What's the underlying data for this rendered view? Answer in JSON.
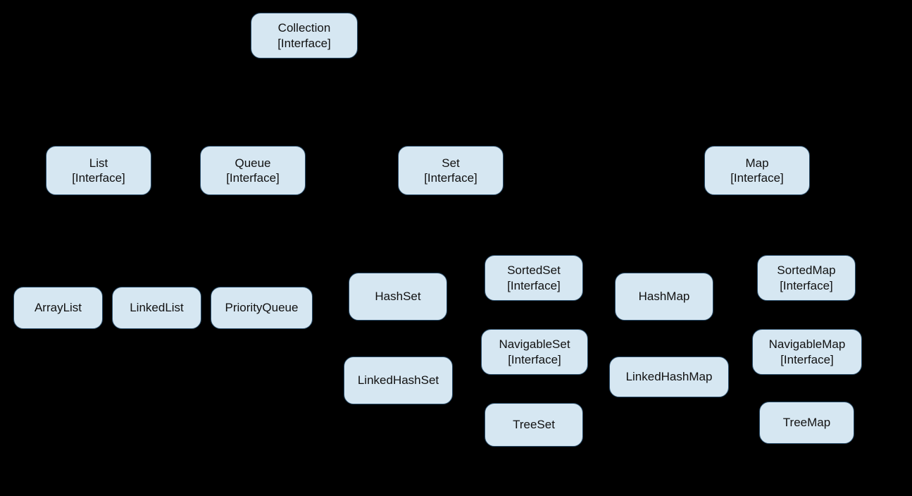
{
  "diagram": {
    "nodes": {
      "collection": {
        "title": "Collection",
        "sub": "[Interface]"
      },
      "list": {
        "title": "List",
        "sub": "[Interface]"
      },
      "queue": {
        "title": "Queue",
        "sub": "[Interface]"
      },
      "set": {
        "title": "Set",
        "sub": "[Interface]"
      },
      "map": {
        "title": "Map",
        "sub": "[Interface]"
      },
      "arraylist": {
        "title": "ArrayList",
        "sub": ""
      },
      "linkedlist": {
        "title": "LinkedList",
        "sub": ""
      },
      "priorityqueue": {
        "title": "PriorityQueue",
        "sub": ""
      },
      "hashset": {
        "title": "HashSet",
        "sub": ""
      },
      "linkedhashset": {
        "title": "LinkedHashSet",
        "sub": ""
      },
      "sortedset": {
        "title": "SortedSet",
        "sub": "[Interface]"
      },
      "navigableset": {
        "title": "NavigableSet",
        "sub": "[Interface]"
      },
      "treeset": {
        "title": "TreeSet",
        "sub": ""
      },
      "hashmap": {
        "title": "HashMap",
        "sub": ""
      },
      "linkedhashmap": {
        "title": "LinkedHashMap",
        "sub": ""
      },
      "sortedmap": {
        "title": "SortedMap",
        "sub": "[Interface]"
      },
      "navigablemap": {
        "title": "NavigableMap",
        "sub": "[Interface]"
      },
      "treemap": {
        "title": "TreeMap",
        "sub": ""
      }
    }
  }
}
